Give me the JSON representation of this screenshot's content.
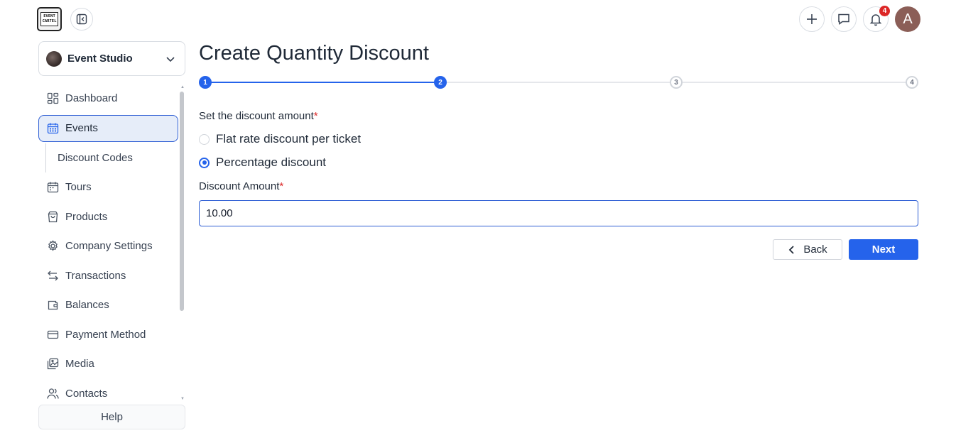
{
  "brand": {
    "logo_line1": "EVENT",
    "logo_line2": "CARTEL"
  },
  "header": {
    "notifications_count": "4",
    "avatar_initial": "A"
  },
  "org": {
    "name": "Event Studio"
  },
  "sidebar": {
    "items": [
      {
        "label": "Dashboard",
        "icon": "dashboard-icon"
      },
      {
        "label": "Events",
        "icon": "calendar-icon",
        "active": true
      },
      {
        "label": "Discount Codes",
        "sub": true
      },
      {
        "label": "Tours",
        "icon": "calendar-icon"
      },
      {
        "label": "Products",
        "icon": "bag-icon"
      },
      {
        "label": "Company Settings",
        "icon": "gear-icon"
      },
      {
        "label": "Transactions",
        "icon": "arrows-icon"
      },
      {
        "label": "Balances",
        "icon": "wallet-icon"
      },
      {
        "label": "Payment Method",
        "icon": "card-icon"
      },
      {
        "label": "Media",
        "icon": "image-icon"
      },
      {
        "label": "Contacts",
        "icon": "users-icon"
      }
    ],
    "help_label": "Help"
  },
  "main": {
    "title": "Create Quantity Discount",
    "steps": [
      "1",
      "2",
      "3",
      "4"
    ],
    "current_step": 2,
    "discount_type_label": "Set the discount amount",
    "required_mark": "*",
    "options": [
      {
        "label": "Flat rate discount per ticket",
        "checked": false
      },
      {
        "label": "Percentage discount",
        "checked": true
      }
    ],
    "amount_label": "Discount Amount",
    "amount_value": "10.00",
    "back_label": "Back",
    "next_label": "Next"
  },
  "colors": {
    "primary": "#2563eb",
    "active_bg": "#e6edf9",
    "required": "#dc2626"
  }
}
